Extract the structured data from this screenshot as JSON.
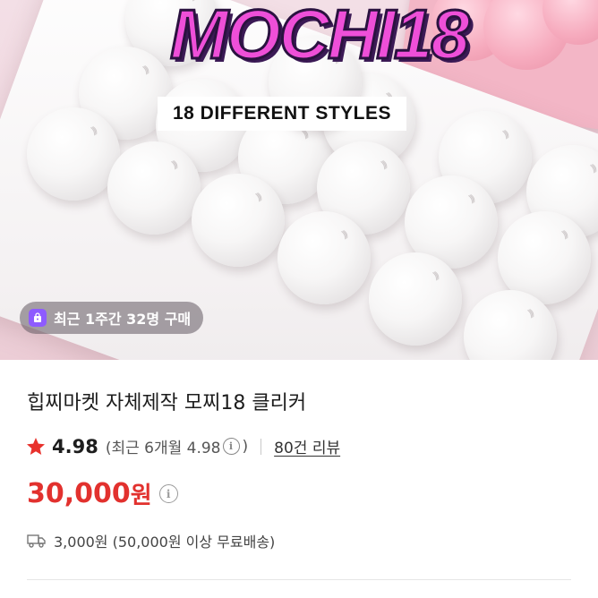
{
  "hero": {
    "brand_text": "MOCHI18",
    "styles_tag": "18 DIFFERENT STYLES",
    "recent_purchase_badge": "최근 1주간 32명 구매"
  },
  "product": {
    "title": "힙찌마켓 자체제작 모찌18 클리커",
    "rating": {
      "score": "4.98",
      "detail_open": "(최근 6개월 4.98",
      "detail_close": ")",
      "review_link": "80건 리뷰"
    },
    "price": {
      "amount": "30,000",
      "unit": "원"
    },
    "shipping": {
      "text": "3,000원 (50,000원 이상 무료배송)"
    }
  },
  "icons": {
    "star": "star-icon",
    "info": "info-icon",
    "shopping_bag": "shopping-bag-icon",
    "delivery_truck": "delivery-truck-icon"
  },
  "colors": {
    "price_red": "#e2312e",
    "star_red": "#e8312c",
    "badge_purple": "#8e5bff",
    "brand_pink": "#ee4fd8"
  }
}
